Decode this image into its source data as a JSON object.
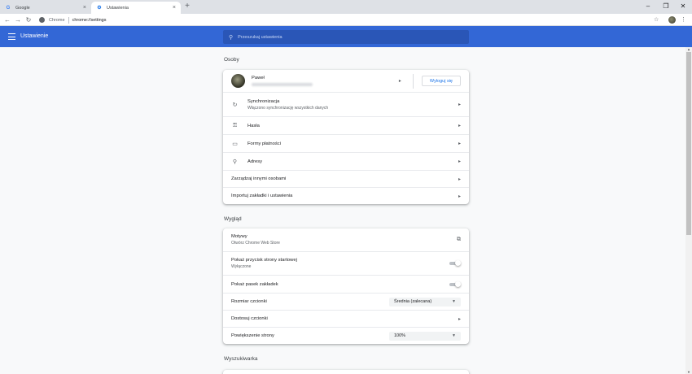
{
  "browser": {
    "tabs": [
      {
        "title": "Google",
        "favicon": "G",
        "close": "×"
      },
      {
        "title": "Ustawienia",
        "favicon": "⚙",
        "close": "×"
      }
    ],
    "new_tab": "+",
    "window_controls": {
      "minimize": "–",
      "maximize": "❐",
      "close": "✕"
    },
    "back": "←",
    "forward": "→",
    "reload": "↻",
    "site_label": "Chrome",
    "url": "chrome://settings",
    "bookmark_star": "☆",
    "menu": "⋮"
  },
  "header": {
    "title": "Ustawienie",
    "search_placeholder": "Przeszukaj ustawienia",
    "accent": "#3367d6"
  },
  "people": {
    "title": "Osoby",
    "profile_name": "Paweł",
    "sign_out": "Wyloguj się",
    "sync_label": "Synchronizacja",
    "sync_sub": "Włączono synchronizację wszystkich danych",
    "passwords": "Hasła",
    "payments": "Formy płatności",
    "addresses": "Adresy",
    "manage_people": "Zarządzaj innymi osobami",
    "import": "Importuj zakładki i ustawienia"
  },
  "appearance": {
    "title": "Wygląd",
    "themes": "Motywy",
    "themes_sub": "Otwórz Chrome Web Store",
    "home_button": "Pokaż przycisk strony startowej",
    "home_button_sub": "Wyłączone",
    "bookmarks_bar": "Pokaż pasek zakładek",
    "font_size": "Rozmiar czcionki",
    "font_size_value": "Średnia (zalecana)",
    "customize_fonts": "Dostosuj czcionki",
    "page_zoom": "Powiększenie strony",
    "page_zoom_value": "100%"
  },
  "search_engine": {
    "title": "Wyszukiwarka"
  }
}
